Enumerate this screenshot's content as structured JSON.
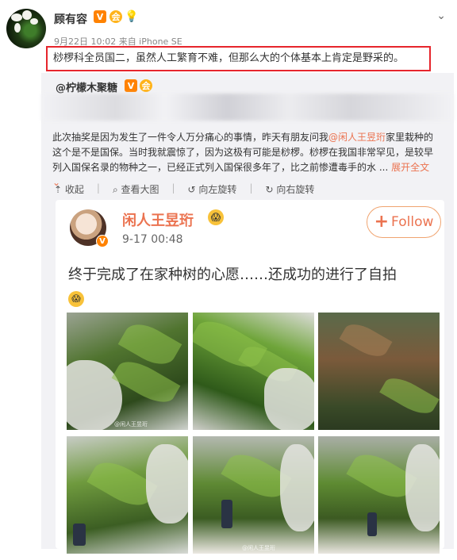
{
  "post": {
    "username": "顾有容",
    "badges": [
      "V",
      "会",
      "💡"
    ],
    "meta": "9月22日 10:02 来自 iPhone SE",
    "text": "桫椤科全员国二，虽然人工繁育不难，但那么大的个体基本上肯定是野采的。"
  },
  "repost": {
    "author": "@柠檬木聚糖",
    "author_badges": [
      "V",
      "会"
    ],
    "text_parts": {
      "a": "此次抽奖是因为发生了一件令人万分痛心的事情，昨天有朋友问我",
      "mention": "@闲人王昱珩",
      "b": "家里栽种的这个是不是国保。当时我就震惊了，因为这极有可能是桫椤。桫椤在我国非常罕见，是较早列入国保名录的物种之一，已经正式列入国保很多年了，比之前惨遭毒手的水 ...",
      "expand": "展开全文 ⌄"
    },
    "actions": [
      "收起",
      "查看大图",
      "向左旋转",
      "向右旋转"
    ]
  },
  "embedded": {
    "name": "闲人王昱珩",
    "time": "9-17 00:48",
    "follow_label": "Follow",
    "text": "终于完成了在家种树的心愿……还成功的进行了自拍",
    "watermark": "@闲人王昱珩"
  },
  "colors": {
    "accent": "#eb7350",
    "highlight_border": "#e6252c",
    "verified": "#ff8200"
  }
}
